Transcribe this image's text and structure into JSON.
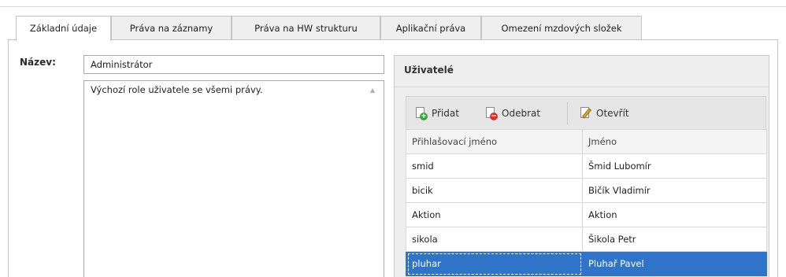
{
  "tabs": [
    {
      "label": "Základní údaje",
      "active": true
    },
    {
      "label": "Práva na záznamy",
      "active": false
    },
    {
      "label": "Práva na HW strukturu",
      "active": false
    },
    {
      "label": "Aplikační práva",
      "active": false
    },
    {
      "label": "Omezení mzdových složek",
      "active": false
    }
  ],
  "form": {
    "name_label": "Název:",
    "name_value": "Administrátor",
    "description": "Výchozí role uživatele se všemi právy.",
    "scroll_arrow": "▲"
  },
  "users": {
    "header": "Uživatelé",
    "toolbar": {
      "add_label": "Přidat",
      "remove_label": "Odebrat",
      "open_label": "Otevřít"
    },
    "columns": [
      "Přihlašovací jméno",
      "Jméno"
    ],
    "rows": [
      {
        "login": "smid",
        "name": "Šmid Lubomír"
      },
      {
        "login": "bicik",
        "name": "Bičík Vladimír"
      },
      {
        "login": "Aktion",
        "name": "Aktion"
      },
      {
        "login": "sikola",
        "name": "Šikola Petr"
      },
      {
        "login": "pluhar",
        "name": "Pluhař Pavel",
        "selected": true
      }
    ]
  },
  "colors": {
    "selection": "#2f74c9",
    "add_badge": "#3aa53a",
    "remove_badge": "#d8322f",
    "pencil": "#e7a72c"
  },
  "icons": [
    "add-document-icon",
    "remove-document-icon",
    "edit-pencil-icon"
  ]
}
